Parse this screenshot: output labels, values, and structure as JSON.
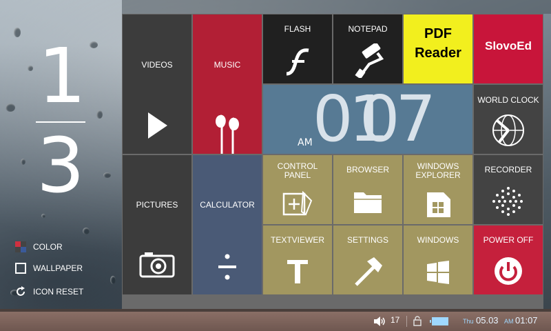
{
  "pager": {
    "current": "1",
    "total": "3"
  },
  "side_options": [
    {
      "label": "COLOR",
      "icon": "color-swatch-icon"
    },
    {
      "label": "WALLPAPER",
      "icon": "wallpaper-square-icon"
    },
    {
      "label": "ICON RESET",
      "icon": "refresh-icon"
    }
  ],
  "tiles": {
    "videos": "VIDEOS",
    "music": "MUSIC",
    "flash": "FLASH",
    "notepad": "NOTEPAD",
    "pdf_reader_line1": "PDF",
    "pdf_reader_line2": "Reader",
    "slovoed": "SlovoEd",
    "world_clock": "WORLD CLOCK",
    "pictures": "PICTURES",
    "calculator": "CALCULATOR",
    "control_panel_line1": "CONTROL",
    "control_panel_line2": "PANEL",
    "browser": "BROWSER",
    "windows_explorer_line1": "WINDOWS",
    "windows_explorer_line2": "EXPLORER",
    "recorder": "RECORDER",
    "textviewer": "TEXTVIEWER",
    "settings": "SETTINGS",
    "windows": "WINDOWS",
    "power_off": "POWER OFF"
  },
  "clock_tile": {
    "ampm": "AM",
    "hours": "01",
    "minutes": "07"
  },
  "statusbar": {
    "volume": "17",
    "day": "Thu",
    "date": "05.03",
    "ampm": "AM",
    "time": "01:07"
  },
  "colors": {
    "dark_tile": "#3c3c3c",
    "music_red": "#b21f35",
    "calculator_slate": "#4a5a76",
    "olive_tiles": "#a29760",
    "clock_steel": "#577a94",
    "pdf_yellow": "#f2ef1e",
    "power_red": "#c5203c"
  }
}
